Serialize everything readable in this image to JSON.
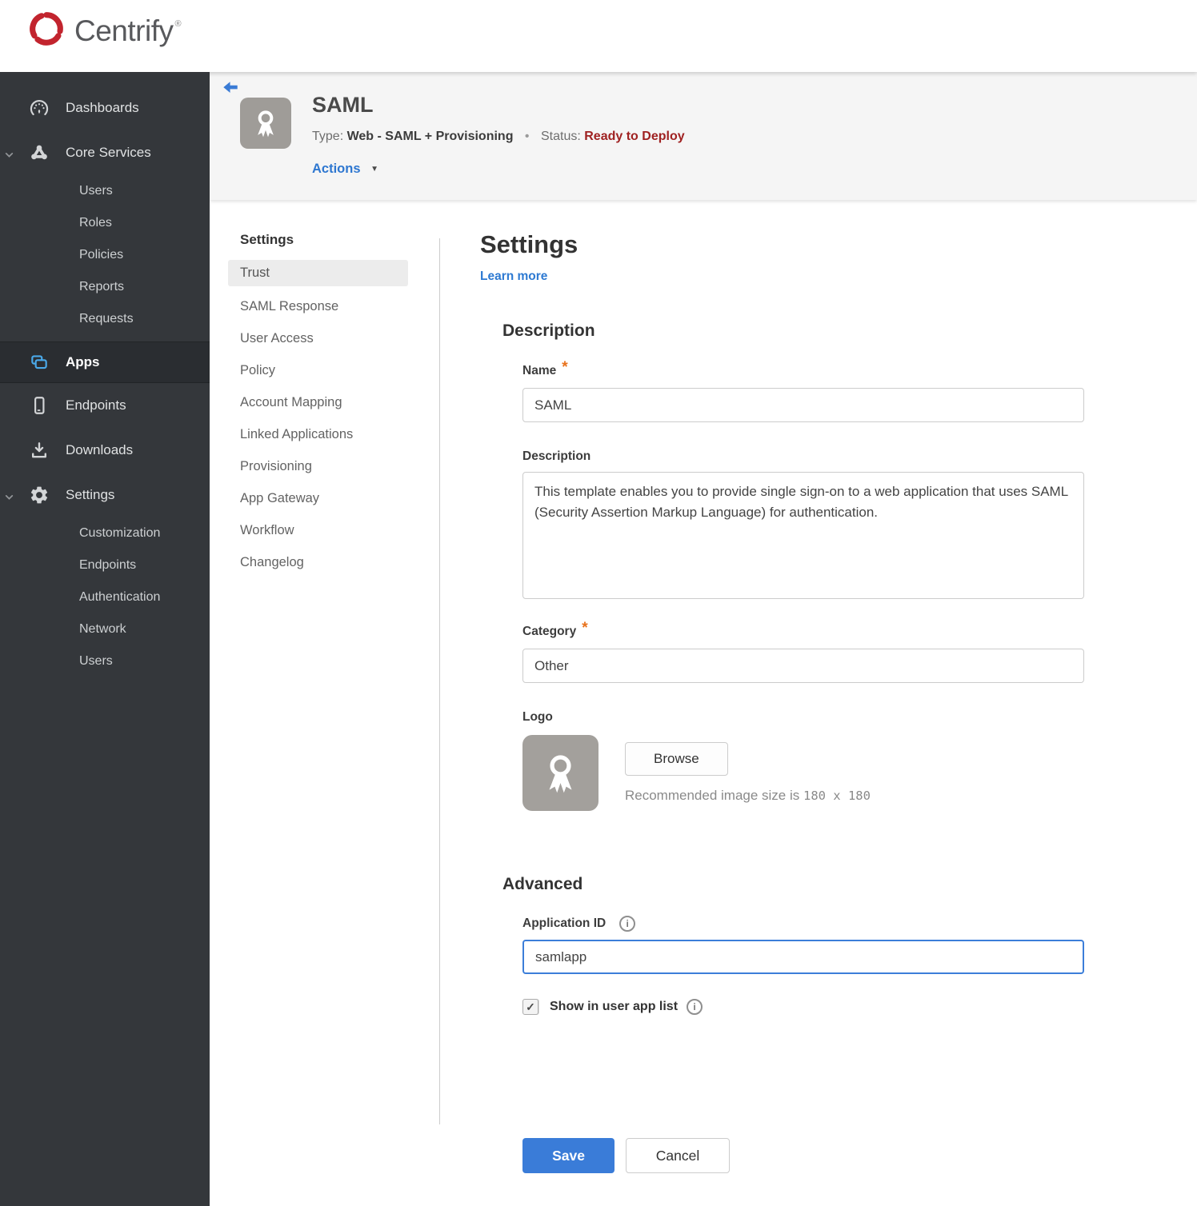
{
  "brand": {
    "name": "Centrify",
    "registered": "®"
  },
  "sidebar": {
    "items": [
      {
        "label": "Dashboards",
        "icon": "gauge-icon"
      },
      {
        "label": "Core Services",
        "icon": "core-services-icon",
        "expanded": true,
        "children": [
          "Users",
          "Roles",
          "Policies",
          "Reports",
          "Requests"
        ]
      },
      {
        "label": "Apps",
        "icon": "apps-icon",
        "active": true
      },
      {
        "label": "Endpoints",
        "icon": "phone-icon"
      },
      {
        "label": "Downloads",
        "icon": "download-icon"
      },
      {
        "label": "Settings",
        "icon": "gear-icon",
        "expanded": true,
        "children": [
          "Customization",
          "Endpoints",
          "Authentication",
          "Network",
          "Users"
        ]
      }
    ]
  },
  "header": {
    "title": "SAML",
    "type_label": "Type:",
    "type_value": "Web - SAML + Provisioning",
    "separator": "•",
    "status_label": "Status:",
    "status_value": "Ready to Deploy",
    "actions_label": "Actions"
  },
  "subnav": {
    "header": "Settings",
    "active_item": "Trust",
    "items": [
      "Trust",
      "SAML Response",
      "User Access",
      "Policy",
      "Account Mapping",
      "Linked Applications",
      "Provisioning",
      "App Gateway",
      "Workflow",
      "Changelog"
    ]
  },
  "content": {
    "title": "Settings",
    "learn_more": "Learn more",
    "description_section": {
      "heading": "Description",
      "name_label": "Name",
      "name_value": "SAML",
      "description_label": "Description",
      "description_value": "This template enables you to provide single sign-on to a web application that uses SAML (Security Assertion Markup Language) for authentication.",
      "category_label": "Category",
      "category_value": "Other",
      "logo_label": "Logo",
      "browse_label": "Browse",
      "logo_hint_prefix": "Recommended image size is ",
      "logo_hint_size": "180 x 180"
    },
    "advanced_section": {
      "heading": "Advanced",
      "app_id_label": "Application ID",
      "app_id_value": "samlapp",
      "show_in_app_list_label": "Show in user app list",
      "checkbox_checked": true
    },
    "footer": {
      "save_label": "Save",
      "cancel_label": "Cancel"
    }
  },
  "icons": {
    "check": "✓",
    "dropdown_arrow": "▼",
    "info": "i",
    "required_marker": "*"
  },
  "colors": {
    "accent_blue": "#3a7cd8",
    "link_blue": "#2e7ad2",
    "status_red": "#9f2121",
    "required_orange": "#e8721c",
    "sidebar_bg": "#34373b",
    "apps_icon_blue": "#4aa9e9",
    "header_band": "#f5f5f5",
    "brand_red": "#c2242e"
  }
}
